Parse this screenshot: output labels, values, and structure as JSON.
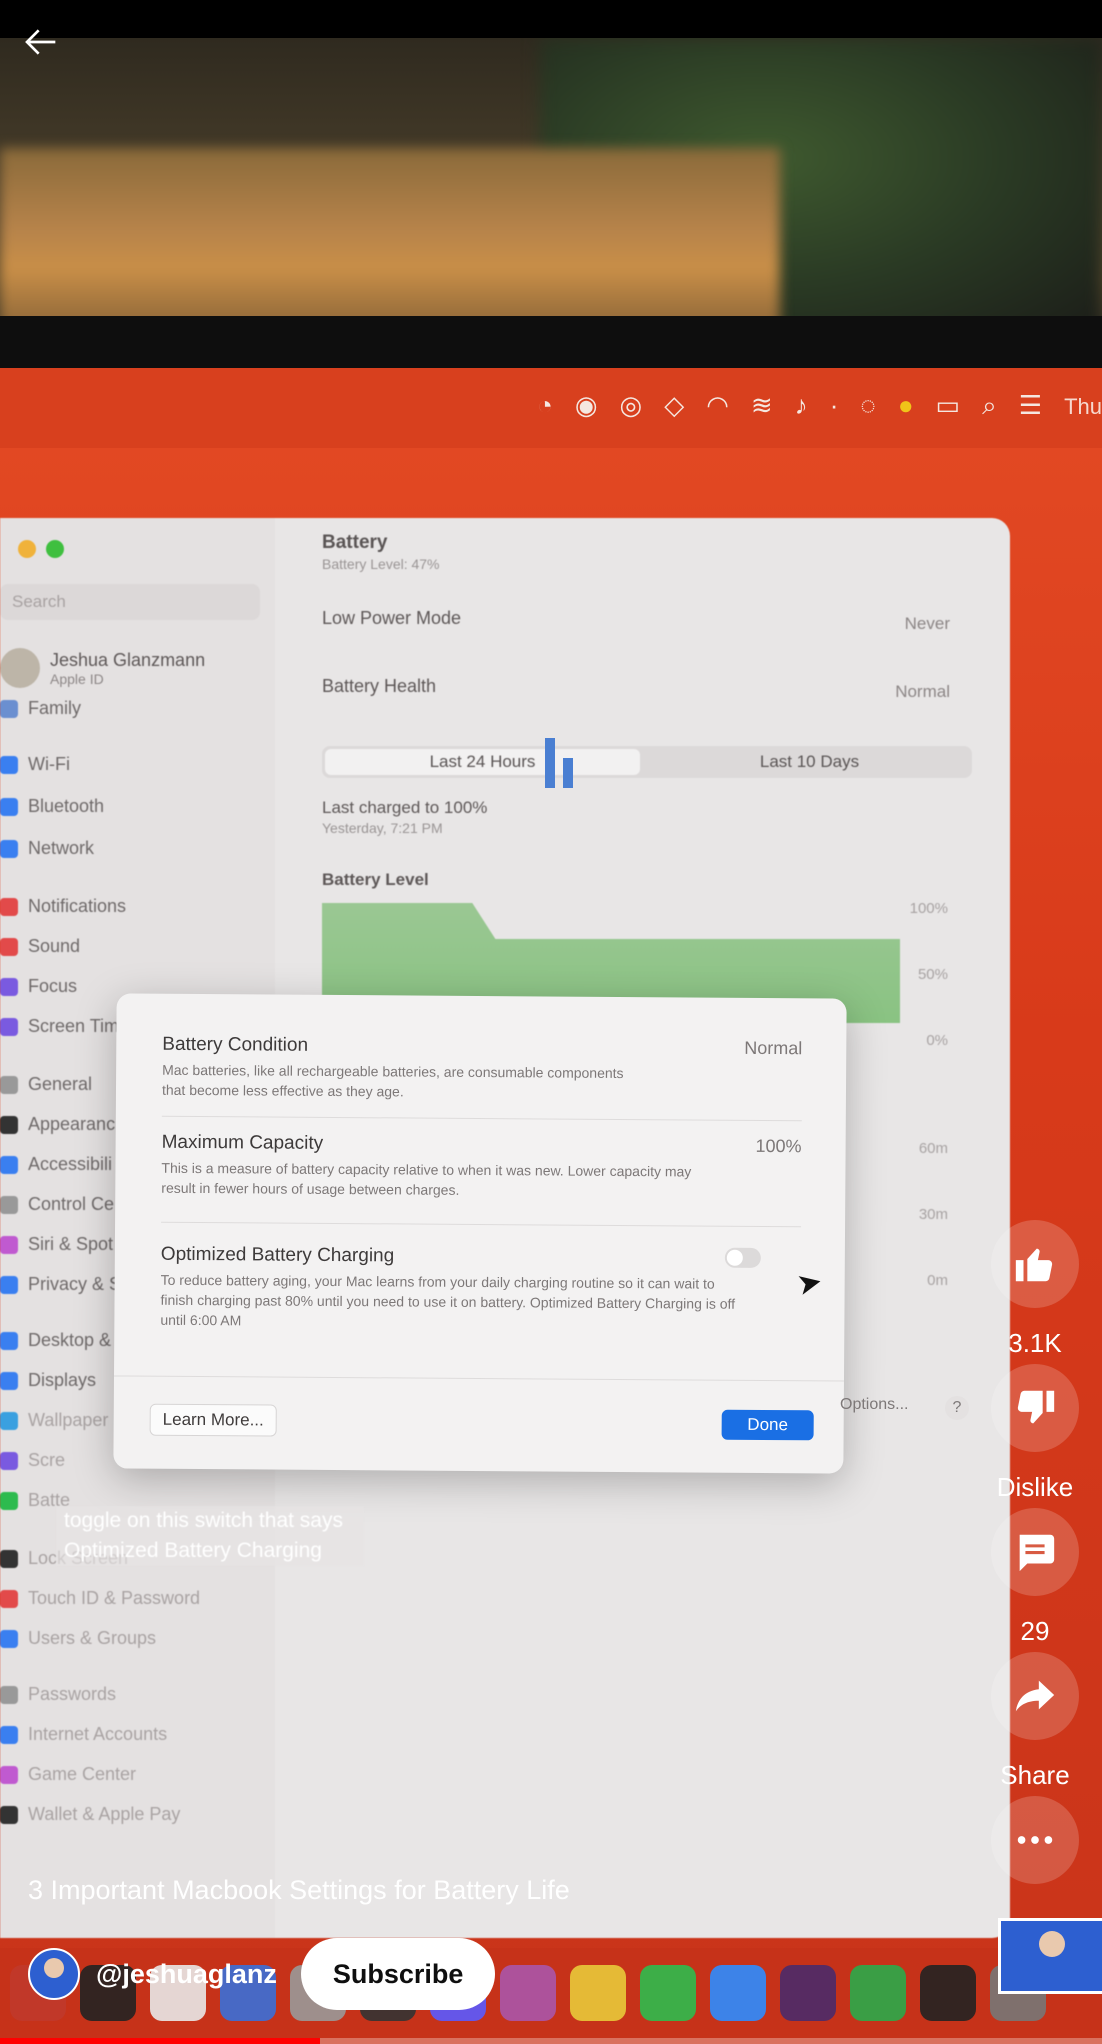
{
  "video": {
    "screen": {
      "menubar_clock": "Thu",
      "sidebar": {
        "search_placeholder": "Search",
        "user_name": "Jeshua Glanzmann",
        "user_sub": "Apple ID",
        "items": [
          {
            "label": "Family"
          },
          {
            "label": "Wi-Fi"
          },
          {
            "label": "Bluetooth"
          },
          {
            "label": "Network"
          },
          {
            "label": "Notifications"
          },
          {
            "label": "Sound"
          },
          {
            "label": "Focus"
          },
          {
            "label": "Screen Tim"
          },
          {
            "label": "General"
          },
          {
            "label": "Appearanc"
          },
          {
            "label": "Accessibili"
          },
          {
            "label": "Control Ce"
          },
          {
            "label": "Siri & Spot"
          },
          {
            "label": "Privacy & S"
          },
          {
            "label": "Desktop &"
          },
          {
            "label": "Displays"
          },
          {
            "label": "Wallpaper"
          },
          {
            "label": "Scre"
          },
          {
            "label": "Batte"
          },
          {
            "label": "Lock Screen"
          },
          {
            "label": "Touch ID & Password"
          },
          {
            "label": "Users & Groups"
          },
          {
            "label": "Passwords"
          },
          {
            "label": "Internet Accounts"
          },
          {
            "label": "Game Center"
          },
          {
            "label": "Wallet & Apple Pay"
          }
        ]
      },
      "pane": {
        "title": "Battery",
        "subtitle": "Battery Level: 47%",
        "low_power_label": "Low Power Mode",
        "low_power_value": "Never",
        "health_label": "Battery Health",
        "health_value": "Normal",
        "tab_24h": "Last 24 Hours",
        "tab_10d": "Last 10 Days",
        "last_charged": "Last charged to 100%",
        "last_charged_time": "Yesterday, 7:21 PM",
        "level_heading": "Battery Level",
        "pct_100": "100%",
        "pct_50": "50%",
        "pct_0": "0%",
        "min_60": "60m",
        "min_30": "30m",
        "min_0": "0m",
        "options_label": "Options...",
        "help": "?"
      },
      "dialog": {
        "condition_title": "Battery Condition",
        "condition_value": "Normal",
        "condition_desc": "Mac batteries, like all rechargeable batteries, are consumable components that become less effective as they age.",
        "capacity_title": "Maximum Capacity",
        "capacity_value": "100%",
        "capacity_desc": "This is a measure of battery capacity relative to when it was new. Lower capacity may result in fewer hours of usage between charges.",
        "optimized_title": "Optimized Battery Charging",
        "optimized_desc": "To reduce battery aging, your Mac learns from your daily charging routine so it can wait to finish charging past 80% until you need to use it on battery. Optimized Battery Charging is off until 6:00 AM",
        "optimized_on": false,
        "learn_more": "Learn More...",
        "done": "Done"
      }
    },
    "caption": "toggle on this switch that says Optimized Battery Charging"
  },
  "overlay": {
    "likes": "3.1K",
    "dislike": "Dislike",
    "comments": "29",
    "share": "Share",
    "title": "3 Important Macbook Settings for Battery Life",
    "channel": "@jeshuaglanz",
    "subscribe": "Subscribe",
    "progress": 0.29
  },
  "colors": {
    "accent_red": "#ff0000",
    "mac_wallpaper": "#d83a1a",
    "done_blue": "#1a6fe4",
    "battery_green": "#7fbf77"
  },
  "icons": [
    "back-arrow-icon",
    "like-icon",
    "dislike-icon",
    "comment-icon",
    "share-icon",
    "more-icon"
  ]
}
